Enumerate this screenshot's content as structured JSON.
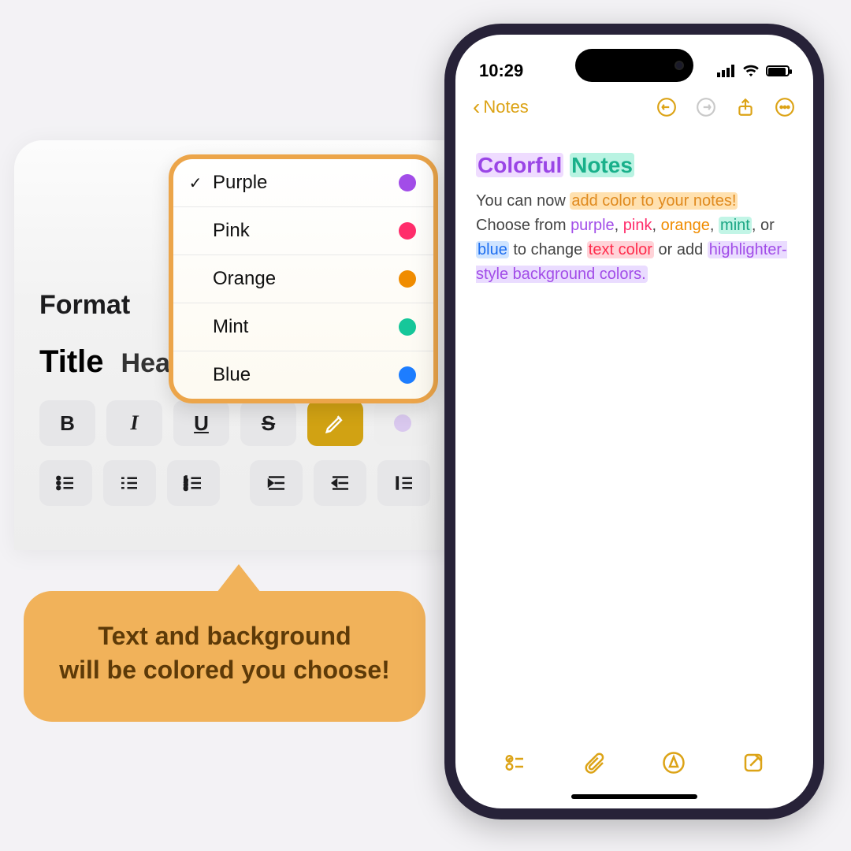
{
  "format_panel": {
    "title": "Format",
    "styles": {
      "title": "Title",
      "heading": "Heading"
    },
    "buttons": {
      "bold": "B",
      "italic": "I",
      "underline": "U",
      "strike": "S"
    }
  },
  "color_menu": {
    "items": [
      {
        "label": "Purple",
        "hex": "#a24de8",
        "selected": true
      },
      {
        "label": "Pink",
        "hex": "#ff2d6b",
        "selected": false
      },
      {
        "label": "Orange",
        "hex": "#f08c00",
        "selected": false
      },
      {
        "label": "Mint",
        "hex": "#16c79a",
        "selected": false
      },
      {
        "label": "Blue",
        "hex": "#1d7dff",
        "selected": false
      }
    ]
  },
  "callout": {
    "line1": "Text and background",
    "line2": "will be colored you choose!"
  },
  "phone": {
    "status": {
      "time": "10:29"
    },
    "nav": {
      "back_label": "Notes"
    },
    "note": {
      "title_word1": "Colorful",
      "title_word2": "Notes",
      "p_lead": "You can now ",
      "p_add_color": "add color to your notes!",
      "p_choose": "Choose from ",
      "w_purple": "purple",
      "w_pink": "pink",
      "w_orange": "orange",
      "w_mint": "mint",
      "p_or": ", or ",
      "w_blue": "blue",
      "p_to_change": " to change ",
      "w_text_color": "text color",
      "p_or_add": " or add ",
      "w_highlighter": "highlighter-style background colors."
    }
  },
  "colors": {
    "accent": "#dca316",
    "menu_border": "#eca54a",
    "callout_bg": "#f1b25a"
  }
}
